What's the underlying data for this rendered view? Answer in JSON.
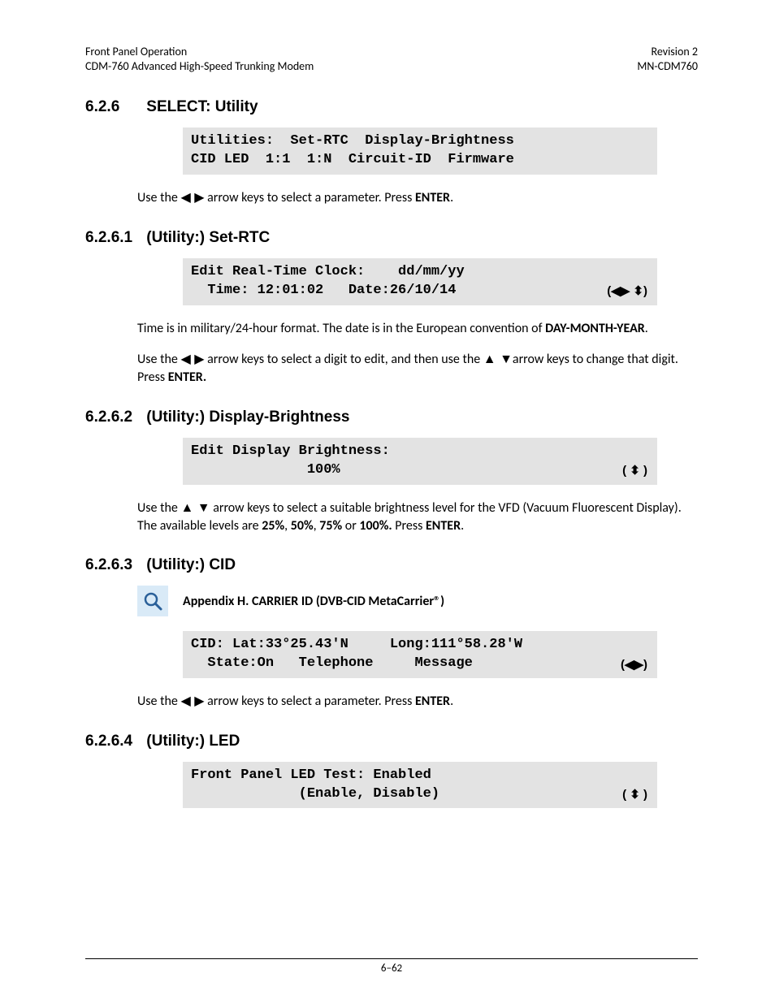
{
  "header": {
    "left1": "Front Panel Operation",
    "left2": "CDM-760 Advanced High-Speed Trunking Modem",
    "right1": "Revision 2",
    "right2": "MN-CDM760"
  },
  "s626": {
    "num": "6.2.6",
    "title": "SELECT: Utility",
    "code_l1": "Utilities:  Set-RTC  Display-Brightness",
    "code_l2": "CID LED  1:1  1:N  Circuit-ID  Firmware",
    "p1_a": "Use the ",
    "p1_b": " arrow keys to select a parameter. Press ",
    "p1_c": "ENTER",
    "p1_d": "."
  },
  "s6261": {
    "num": "6.2.6.1",
    "title": "(Utility:) Set-RTC",
    "code_l1": "Edit Real-Time Clock:    dd/mm/yy",
    "code_l2": "  Time: 12:01:02   Date:26/10/14",
    "arrows": "(◀▶ ⬍)",
    "p1_a": "Time is in military/24-hour format. The date is in the European convention of ",
    "p1_b": "DAY-MONTH-YEAR",
    "p1_c": ".",
    "p2_a": "Use the ",
    "p2_b": " arrow keys to select a digit to edit, and then use the ",
    "p2_c": "arrow keys to change that digit. Press ",
    "p2_d": "ENTER."
  },
  "s6262": {
    "num": "6.2.6.2",
    "title": "(Utility:) Display-Brightness",
    "code_l1": "Edit Display Brightness:",
    "code_l2": "              100%",
    "arrows": "( ⬍ )",
    "p1_a": "Use the ",
    "p1_b": " arrow keys to select a suitable brightness level for the VFD (Vacuum Fluorescent Display). The available levels are ",
    "p1_c": "25%",
    "p1_d": ", ",
    "p1_e": "50%",
    "p1_f": ", ",
    "p1_g": "75%",
    "p1_h": " or ",
    "p1_i": "100%.",
    "p1_j": " Press ",
    "p1_k": "ENTER",
    "p1_l": "."
  },
  "s6263": {
    "num": "6.2.6.3",
    "title": "(Utility:) CID",
    "appendix": "Appendix H. CARRIER ID (DVB-CID MetaCarrier®)",
    "code_l1": "CID: Lat:33°25.43'N     Long:111°58.28'W",
    "code_l2": "  State:On   Telephone     Message",
    "arrows": "(◀▶)",
    "p1_a": "Use the ",
    "p1_b": " arrow keys to select a parameter. Press ",
    "p1_c": "ENTER",
    "p1_d": "."
  },
  "s6264": {
    "num": "6.2.6.4",
    "title": "(Utility:) LED",
    "code_l1": "Front Panel LED Test: Enabled",
    "code_l2": "             (Enable, Disable)",
    "arrows": "( ⬍ )"
  },
  "footer": {
    "page": "6–62"
  }
}
